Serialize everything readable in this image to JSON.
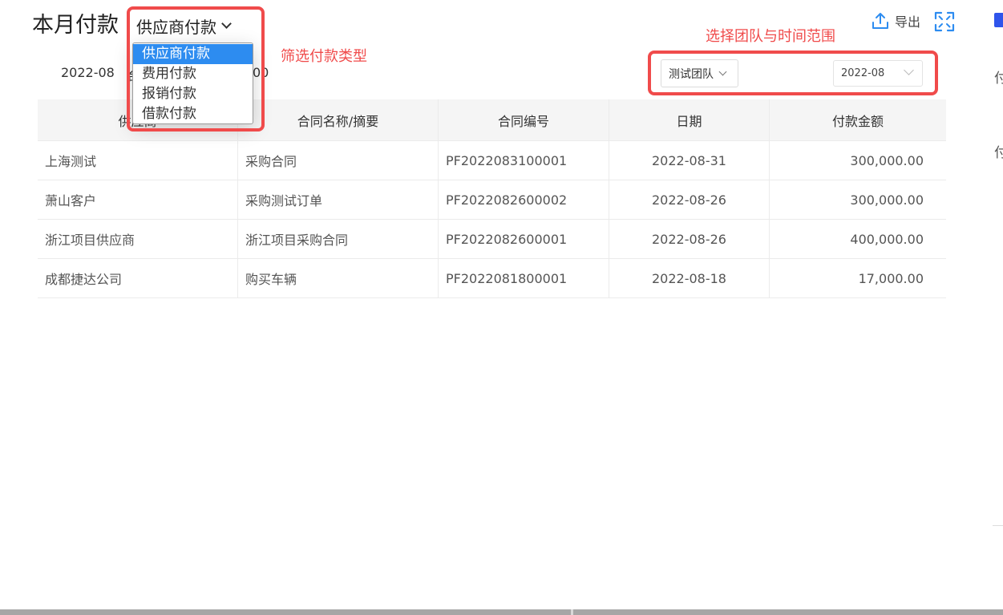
{
  "modal": {
    "title": "本月付款",
    "type_select_value": "供应商付款",
    "summary_month": "2022-08",
    "summary_mid": "合",
    "summary_tail": "00",
    "export_label": "导出"
  },
  "filters": {
    "team": "测试团队",
    "date": "2022-08"
  },
  "dropdown": {
    "options": [
      "供应商付款",
      "费用付款",
      "报销付款",
      "借款付款"
    ],
    "selected": "供应商付款"
  },
  "table": {
    "columns": [
      "供应商",
      "合同名称/摘要",
      "合同编号",
      "日期",
      "付款金额"
    ],
    "rows": [
      [
        "上海测试",
        "采购合同",
        "PF2022083100001",
        "2022-08-31",
        "300,000.00"
      ],
      [
        "萧山客户",
        "采购测试订单",
        "PF2022082600002",
        "2022-08-26",
        "300,000.00"
      ],
      [
        "浙江项目供应商",
        "浙江项目采购合同",
        "PF2022082600001",
        "2022-08-26",
        "400,000.00"
      ],
      [
        "成都捷达公司",
        "购买车辆",
        "PF2022081800001",
        "2022-08-18",
        "17,000.00"
      ]
    ]
  },
  "annotations": {
    "payment_type": "筛选付款类型",
    "team_time": "选择团队与时间范围"
  },
  "background": {
    "glyph_a": "付",
    "glyph_b": "付"
  },
  "colors": {
    "accent": "#2d8cf0",
    "annotation": "#f04b4b",
    "header_bg": "#f5f5f5"
  }
}
